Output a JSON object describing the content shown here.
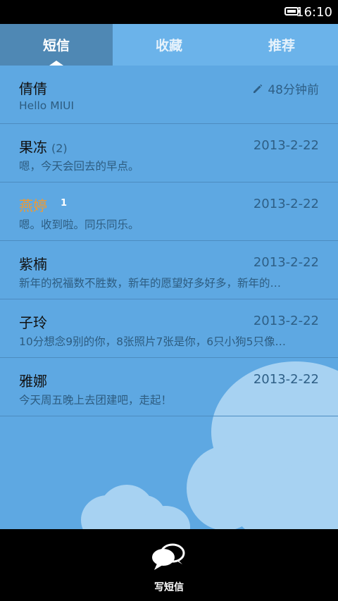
{
  "status_bar": {
    "time": "16:10",
    "battery_icon": "battery-icon"
  },
  "tabs": [
    {
      "label": "短信",
      "active": true
    },
    {
      "label": "收藏",
      "active": false
    },
    {
      "label": "推荐",
      "active": false
    }
  ],
  "messages": [
    {
      "name": "倩倩",
      "count": "",
      "badge": "",
      "unread": false,
      "time": "48分钟前",
      "draft": true,
      "preview": "Hello MIUI"
    },
    {
      "name": "果冻",
      "count": "(2)",
      "badge": "",
      "unread": false,
      "time": "2013-2-22",
      "draft": false,
      "preview": "嗯，今天会回去的早点。"
    },
    {
      "name": "燕婷",
      "count": "",
      "badge": "1",
      "unread": true,
      "time": "2013-2-22",
      "draft": false,
      "preview": "嗯。收到啦。同乐同乐。"
    },
    {
      "name": "紫楠",
      "count": "",
      "badge": "",
      "unread": false,
      "time": "2013-2-22",
      "draft": false,
      "preview": "新年的祝福数不胜数，新年的愿望好多好多，新年的…"
    },
    {
      "name": "子玲",
      "count": "",
      "badge": "",
      "unread": false,
      "time": "2013-2-22",
      "draft": false,
      "preview": "10分想念9别的你，8张照片7张是你，6只小狗5只像…"
    },
    {
      "name": "雅娜",
      "count": "",
      "badge": "",
      "unread": false,
      "time": "2013-2-22",
      "draft": false,
      "preview": "今天周五晚上去团建吧，走起！"
    }
  ],
  "bottom_bar": {
    "compose_label": "写短信",
    "compose_icon": "chat-bubbles-icon"
  },
  "colors": {
    "accent_unread": "#f29a2e",
    "background": "#5ea8e2",
    "active_tab": "#4f88b4"
  }
}
